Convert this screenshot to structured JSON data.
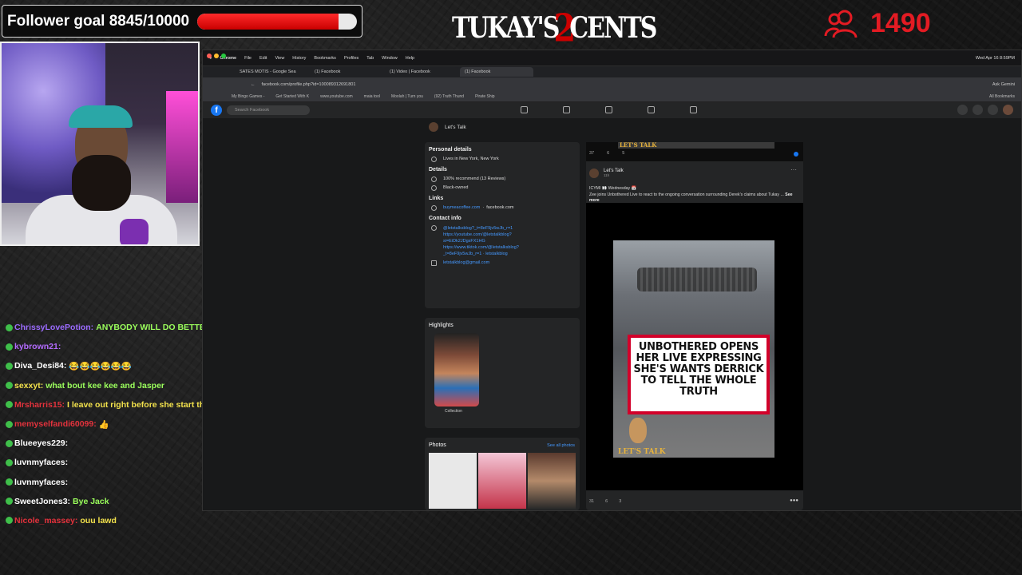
{
  "overlay": {
    "follower_goal": "Follower goal 8845/10000",
    "follower_goal_progress": 0.8845,
    "logo_left": "TUKAY'S",
    "logo_mid": "2",
    "logo_right": "CENTS",
    "viewer_count": "1490"
  },
  "colors": {
    "accent_red": "#e31b23",
    "facebook_blue": "#1877f2",
    "chat_msg": "#f3e24c"
  },
  "chat": [
    {
      "user": "ChrissyLovePotion:",
      "color": "#9b6bff",
      "msg": "ANYBODY WILL DO BETTER THAN HER",
      "msg_color": "#9bff5c"
    },
    {
      "user": "kybrown21:",
      "color": "#b36bff",
      "msg": "",
      "msg_color": "#f3e24c"
    },
    {
      "user": "Diva_Desi84:",
      "color": "#ffffff",
      "msg": "😂😂😂😂😂😂",
      "msg_color": "#f3e24c"
    },
    {
      "user": "sexxyt:",
      "color": "#f3e24c",
      "msg": "what bout kee kee and Jasper",
      "msg_color": "#9bff5c"
    },
    {
      "user": "Mrsharris15:",
      "color": "#e3323c",
      "msg": "I leave out right before she start the prayer 😂😂",
      "msg_color": "#f3e24c"
    },
    {
      "user": "memyselfandi60099:",
      "color": "#e3323c",
      "msg": "👍",
      "msg_color": "#f3e24c"
    },
    {
      "user": "Blueeyes229:",
      "color": "#ffffff",
      "msg": "",
      "msg_color": "#f3e24c"
    },
    {
      "user": "luvnmyfaces:",
      "color": "#ffffff",
      "msg": "",
      "msg_color": "#f3e24c"
    },
    {
      "user": "luvnmyfaces:",
      "color": "#ffffff",
      "msg": "",
      "msg_color": "#f3e24c"
    },
    {
      "user": "SweetJones3:",
      "color": "#ffffff",
      "msg": "Bye Jack",
      "msg_color": "#9bff5c"
    },
    {
      "user": "Nicole_massey:",
      "color": "#e3323c",
      "msg": "ouu lawd",
      "msg_color": "#f3e24c"
    }
  ],
  "mac_menu": [
    "Chrome",
    "File",
    "Edit",
    "View",
    "History",
    "Bookmarks",
    "Profiles",
    "Tab",
    "Window",
    "Help"
  ],
  "mac_clock": "Wed Apr 16 8:59PM",
  "browser": {
    "tabs": [
      "SATES MOTIS - Google Sea",
      "(1) Facebook",
      "(1) Video | Facebook",
      "(1) Facebook"
    ],
    "url": "facebook.com/profile.php?id=100089312691801",
    "bookmarks": [
      "My Bingo Games -",
      "Get Started With K",
      "www.youtube.com",
      "maia tool",
      "Moolah | Turn you",
      "(92) Truth Thund",
      "Pirate Ship"
    ],
    "all_bookmarks": "All Bookmarks",
    "ask_gemini": "Ask Gemini"
  },
  "facebook": {
    "search_placeholder": "Search Facebook",
    "page_name": "Let's Talk",
    "personal_details_title": "Personal details",
    "location": "Lives in New York, New York",
    "details_title": "Details",
    "recommend": "100% recommend (13 Reviews)",
    "black_owned": "Black-owned",
    "links_title": "Links",
    "link1": "buymeacoffee.com",
    "link2": "facebook.com",
    "contact_title": "Contact info",
    "contact_lines": [
      "@letstalksblog?_t=8eF9jv5wJb_r=1",
      "https://youtube.com/@letstalkblog?",
      "si=EiDk2JDgsFX1HG",
      "https://www.tiktok.com/@letstalksblog?",
      "_t=8eF9jv5wJb_r=1 · letstalkblog"
    ],
    "email": "letstalkblog@gmail.com",
    "highlights_title": "Highlights",
    "highlight_caption": "Collection",
    "photos_title": "Photos",
    "see_all_photos": "See all photos",
    "post": {
      "banner": "LET'S TALK",
      "top_reacts": [
        "37",
        "6",
        "5"
      ],
      "author": "Let's Talk",
      "time": "11h",
      "line1": "ICYMI 👀 Wednesday 📅",
      "line2": "Zee joins Unbothered Live to react to the ongoing conversation surrounding Derek's claims about Tukay ...",
      "see_more": "See more",
      "video_caption": "UNBOTHERED OPENS HER LIVE EXPRESSING SHE'S WANTS DERRICK TO TELL THE  WHOLE TRUTH",
      "video_logo": "LET'S TALK",
      "bottom_reacts": [
        "31",
        "6",
        "3"
      ]
    }
  }
}
